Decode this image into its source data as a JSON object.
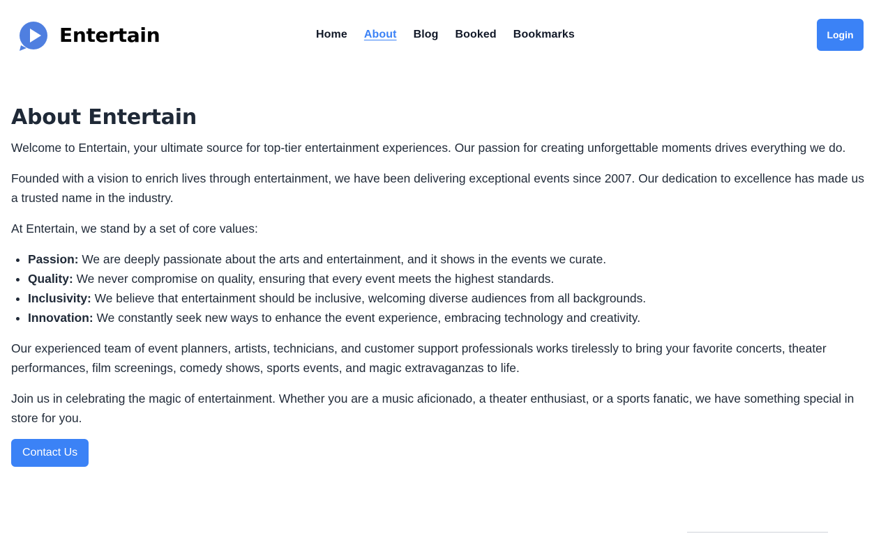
{
  "brand": {
    "name": "Entertain",
    "logo_icon": "play-chat-bubble-icon",
    "logo_color": "#3b82f6"
  },
  "nav": {
    "items": [
      {
        "label": "Home",
        "active": false
      },
      {
        "label": "About",
        "active": true
      },
      {
        "label": "Blog",
        "active": false
      },
      {
        "label": "Booked",
        "active": false
      },
      {
        "label": "Bookmarks",
        "active": false
      }
    ],
    "active_color": "#3b82f6"
  },
  "header": {
    "login_label": "Login"
  },
  "about": {
    "title": "About Entertain",
    "intro": "Welcome to Entertain, your ultimate source for top-tier entertainment experiences. Our passion for creating unforgettable moments drives everything we do.",
    "history": "Founded with a vision to enrich lives through entertainment, we have been delivering exceptional events since 2007. Our dedication to excellence has made us a trusted name in the industry.",
    "values_intro": "At Entertain, we stand by a set of core values:",
    "values": [
      {
        "name": "Passion:",
        "text": " We are deeply passionate about the arts and entertainment, and it shows in the events we curate."
      },
      {
        "name": "Quality:",
        "text": " We never compromise on quality, ensuring that every event meets the highest standards."
      },
      {
        "name": "Inclusivity:",
        "text": " We believe that entertainment should be inclusive, welcoming diverse audiences from all backgrounds."
      },
      {
        "name": "Innovation:",
        "text": " We constantly seek new ways to enhance the event experience, embracing technology and creativity."
      }
    ],
    "team": "Our experienced team of event planners, artists, technicians, and customer support professionals works tirelessly to bring your favorite concerts, theater performances, film screenings, comedy shows, sports events, and magic extravaganzas to life.",
    "join": "Join us in celebrating the magic of entertainment. Whether you are a music aficionado, a theater enthusiast, or a sports fanatic, we have something special in store for you.",
    "contact_label": "Contact Us"
  },
  "colors": {
    "primary": "#3b82f6",
    "text": "#1f2937"
  }
}
